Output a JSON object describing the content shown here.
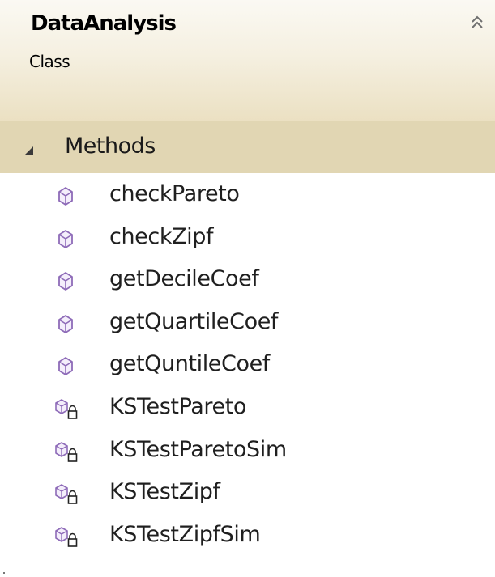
{
  "class": {
    "name": "DataAnalysis",
    "kind": "Class",
    "collapse_icon": "chevron-double-up-icon"
  },
  "sections": [
    {
      "label": "Methods",
      "expanded": true,
      "members": [
        {
          "name": "checkPareto",
          "icon": "public-method-icon"
        },
        {
          "name": "checkZipf",
          "icon": "public-method-icon"
        },
        {
          "name": "getDecileCoef",
          "icon": "public-method-icon"
        },
        {
          "name": "getQuartileCoef",
          "icon": "public-method-icon"
        },
        {
          "name": "getQuntileCoef",
          "icon": "public-method-icon"
        },
        {
          "name": "KSTestPareto",
          "icon": "private-method-icon"
        },
        {
          "name": "KSTestParetoSim",
          "icon": "private-method-icon"
        },
        {
          "name": "KSTestZipf",
          "icon": "private-method-icon"
        },
        {
          "name": "KSTestZipfSim",
          "icon": "private-method-icon"
        }
      ]
    }
  ],
  "colors": {
    "header_bg": "#f5f0e1",
    "section_bg": "#e1d6b3",
    "method_icon": "#8e6bb8"
  }
}
